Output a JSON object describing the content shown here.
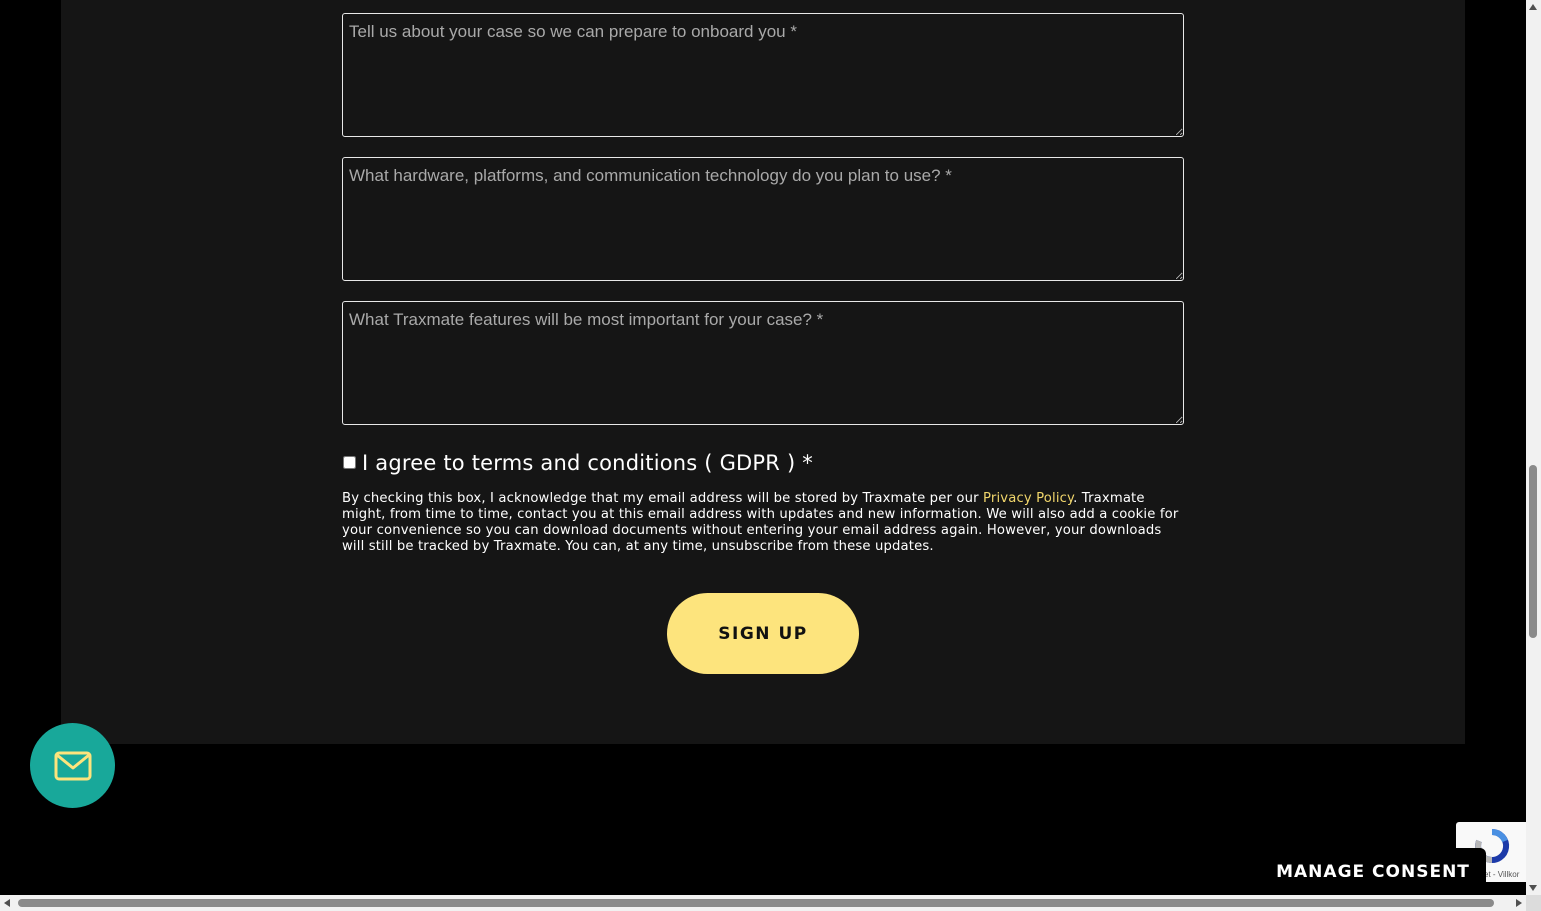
{
  "form": {
    "case_placeholder": "Tell us about your case so we can prepare to onboard you *",
    "hardware_placeholder": "What hardware, platforms, and communication technology do you plan to use? *",
    "features_placeholder": "What Traxmate features will be most important for your case? *",
    "gdpr_label": "I agree to terms and conditions ( GDPR ) *",
    "disclaimer_before": "By checking this box, I acknowledge that my email address will be stored by Traxmate per our ",
    "privacy_link": "Privacy Policy",
    "disclaimer_after": ". Traxmate might, from time to time, contact you at this email address with updates and new information. We will also add a cookie for your convenience so you can download documents without entering your email address again. However, your downloads will still be tracked by Traxmate. You can, at any time, unsubscribe from these updates.",
    "submit_label": "SIGN UP"
  },
  "widgets": {
    "mail_icon": "envelope-icon",
    "manage_consent_label": "MANAGE CONSENT",
    "recaptcha_text": "et - Villkor"
  },
  "colors": {
    "page_background": "#000000",
    "panel_background": "#151515",
    "accent_yellow": "#fde47d",
    "link_yellow": "#f1d66b",
    "fab_teal": "#18a89a"
  }
}
